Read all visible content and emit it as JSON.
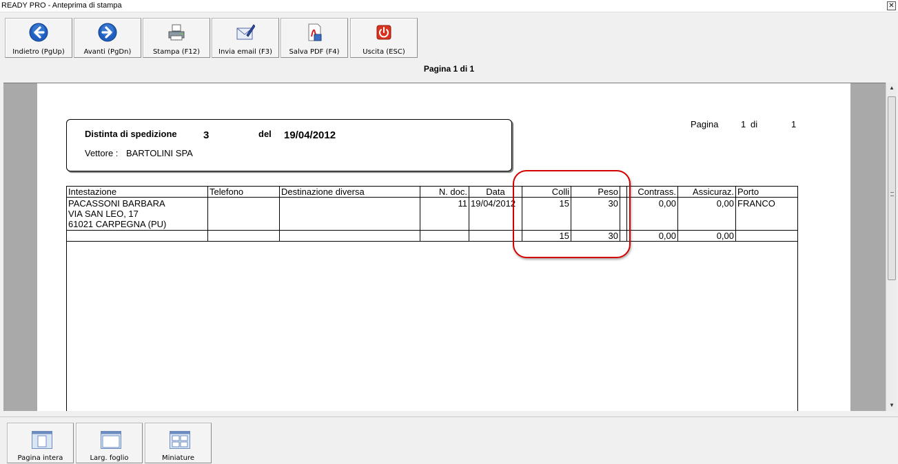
{
  "window": {
    "title": "READY PRO - Anteprima di stampa",
    "close_glyph": "✕"
  },
  "toolbar": {
    "back_label": "Indietro (PgUp)",
    "forward_label": "Avanti (PgDn)",
    "print_label": "Stampa (F12)",
    "email_label": "Invia email (F3)",
    "pdf_label": "Salva PDF (F4)",
    "exit_label": "Uscita (ESC)"
  },
  "page_indicator": "Pagina 1 di 1",
  "document": {
    "title_label": "Distinta di spedizione",
    "number": "3",
    "del_label": "del",
    "date": "19/04/2012",
    "carrier_label": "Vettore :",
    "carrier": "BARTOLINI SPA",
    "page_label": "Pagina",
    "page_num": "1",
    "page_of": "di",
    "page_total": "1"
  },
  "table": {
    "headers": [
      "Intestazione",
      "Telefono",
      "Destinazione diversa",
      "N. doc.",
      "Data",
      "Colli",
      "Peso",
      "",
      "Contrass.",
      "Assicuraz.",
      "Porto"
    ],
    "row": {
      "intestazione_line1": "PACASSONI BARBARA",
      "intestazione_line2": "VIA SAN LEO, 17",
      "intestazione_line3": "61021 CARPEGNA (PU)",
      "telefono": "",
      "destinazione": "",
      "n_doc": "11",
      "data": "19/04/2012",
      "colli": "15",
      "peso": "30",
      "extra": "",
      "contrass": "0,00",
      "assicuraz": "0,00",
      "porto": "FRANCO"
    },
    "totals": {
      "colli": "15",
      "peso": "30",
      "contrass": "0,00",
      "assicuraz": "0,00"
    }
  },
  "bottom_toolbar": {
    "full_page_label": "Pagina intera",
    "page_width_label": "Larg. foglio",
    "thumbnails_label": "Miniature"
  },
  "colors": {
    "highlight": "#d40000",
    "nav_blue": "#1f5fbf",
    "exit_red": "#d9321f"
  }
}
